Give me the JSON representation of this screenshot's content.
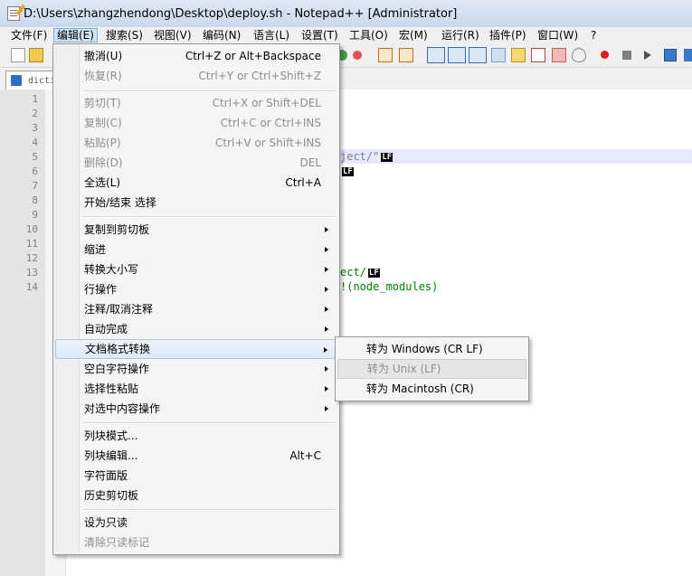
{
  "window": {
    "title": "D:\\Users\\zhangzhendong\\Desktop\\deploy.sh - Notepad++ [Administrator]"
  },
  "menubar": {
    "items": [
      "文件(F)",
      "编辑(E)",
      "搜索(S)",
      "视图(V)",
      "编码(N)",
      "语言(L)",
      "设置(T)",
      "工具(O)",
      "宏(M)",
      "运行(R)",
      "插件(P)",
      "窗口(W)",
      "?"
    ]
  },
  "tab": {
    "label": "dicti"
  },
  "editor": {
    "line_numbers": [
      "1",
      "2",
      "3",
      "4",
      "5",
      "6",
      "7",
      "8",
      "9",
      "10",
      "11",
      "12",
      "13",
      "14"
    ],
    "visible_fragments": {
      "line5": "ject/\"",
      "line13": "ect/",
      "line14": "!(node_modules)",
      "eol_marker": "LF"
    }
  },
  "edit_menu": {
    "items": [
      {
        "label": "撤消(U)",
        "shortcut": "Ctrl+Z or Alt+Backspace",
        "disabled": false
      },
      {
        "label": "恢复(R)",
        "shortcut": "Ctrl+Y or Ctrl+Shift+Z",
        "disabled": true
      },
      {
        "label": "剪切(T)",
        "shortcut": "Ctrl+X or Shift+DEL",
        "disabled": true
      },
      {
        "label": "复制(C)",
        "shortcut": "Ctrl+C or Ctrl+INS",
        "disabled": true
      },
      {
        "label": "粘贴(P)",
        "shortcut": "Ctrl+V or Shift+INS",
        "disabled": true
      },
      {
        "label": "删除(D)",
        "shortcut": "DEL",
        "disabled": true
      },
      {
        "label": "全选(L)",
        "shortcut": "Ctrl+A",
        "disabled": false
      },
      {
        "label": "开始/结束 选择",
        "shortcut": "",
        "disabled": false
      },
      {
        "label": "复制到剪切板",
        "submenu": true
      },
      {
        "label": "缩进",
        "submenu": true
      },
      {
        "label": "转换大小写",
        "submenu": true
      },
      {
        "label": "行操作",
        "submenu": true
      },
      {
        "label": "注释/取消注释",
        "submenu": true
      },
      {
        "label": "自动完成",
        "submenu": true
      },
      {
        "label": "文档格式转换",
        "submenu": true,
        "highlighted": true
      },
      {
        "label": "空白字符操作",
        "submenu": true
      },
      {
        "label": "选择性粘贴",
        "submenu": true
      },
      {
        "label": "对选中内容操作",
        "submenu": true
      },
      {
        "label": "列块模式...",
        "shortcut": ""
      },
      {
        "label": "列块编辑...",
        "shortcut": "Alt+C"
      },
      {
        "label": "字符面版",
        "shortcut": ""
      },
      {
        "label": "历史剪切板",
        "shortcut": ""
      },
      {
        "label": "设为只读",
        "shortcut": "",
        "disabled": false
      },
      {
        "label": "清除只读标记",
        "shortcut": "",
        "disabled": true
      }
    ]
  },
  "eol_submenu": {
    "items": [
      {
        "label": "转为 Windows (CR LF)",
        "disabled": false
      },
      {
        "label": "转为 Unix (LF)",
        "disabled": true,
        "highlighted": true
      },
      {
        "label": "转为 Macintosh (CR)",
        "disabled": false
      }
    ]
  },
  "colors": {
    "menu_highlight": "#dde9f8",
    "current_line": "#e8e8ff",
    "code_green": "#008000"
  }
}
